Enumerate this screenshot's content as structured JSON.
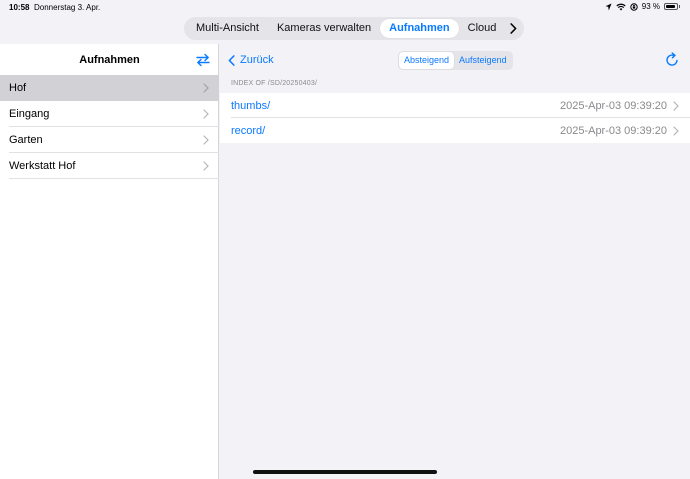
{
  "status_bar": {
    "time": "10:58",
    "date": "Donnerstag 3. Apr.",
    "battery": "93 %",
    "battery_level": 0.93,
    "icons": [
      "location-icon",
      "wifi-icon",
      "orientation-lock-icon",
      "battery-icon"
    ]
  },
  "tabs": {
    "items": [
      {
        "label": "Multi-Ansicht"
      },
      {
        "label": "Kameras verwalten"
      },
      {
        "label": "Aufnahmen",
        "active": true
      },
      {
        "label": "Cloud"
      }
    ],
    "more_icon": "chevron-right-icon"
  },
  "sidebar": {
    "title": "Aufnahmen",
    "swap_icon": "swap-arrows-icon",
    "items": [
      {
        "label": "Hof",
        "selected": true
      },
      {
        "label": "Eingang"
      },
      {
        "label": "Garten"
      },
      {
        "label": "Werkstatt Hof"
      }
    ]
  },
  "main": {
    "back_label": "Zurück",
    "sort": {
      "options": [
        "Absteigend",
        "Aufsteigend"
      ],
      "selected": "Absteigend"
    },
    "refresh_icon": "refresh-icon",
    "path": "INDEX OF /SD/20250403/",
    "files": [
      {
        "name": "thumbs/",
        "date": "2025-Apr-03 09:39:20"
      },
      {
        "name": "record/",
        "date": "2025-Apr-03 09:39:20"
      }
    ]
  },
  "colors": {
    "accent": "#0a7aff",
    "background": "#f2f2f7",
    "selected_row": "#d1d1d6",
    "secondary_text": "#8a8a8e"
  }
}
